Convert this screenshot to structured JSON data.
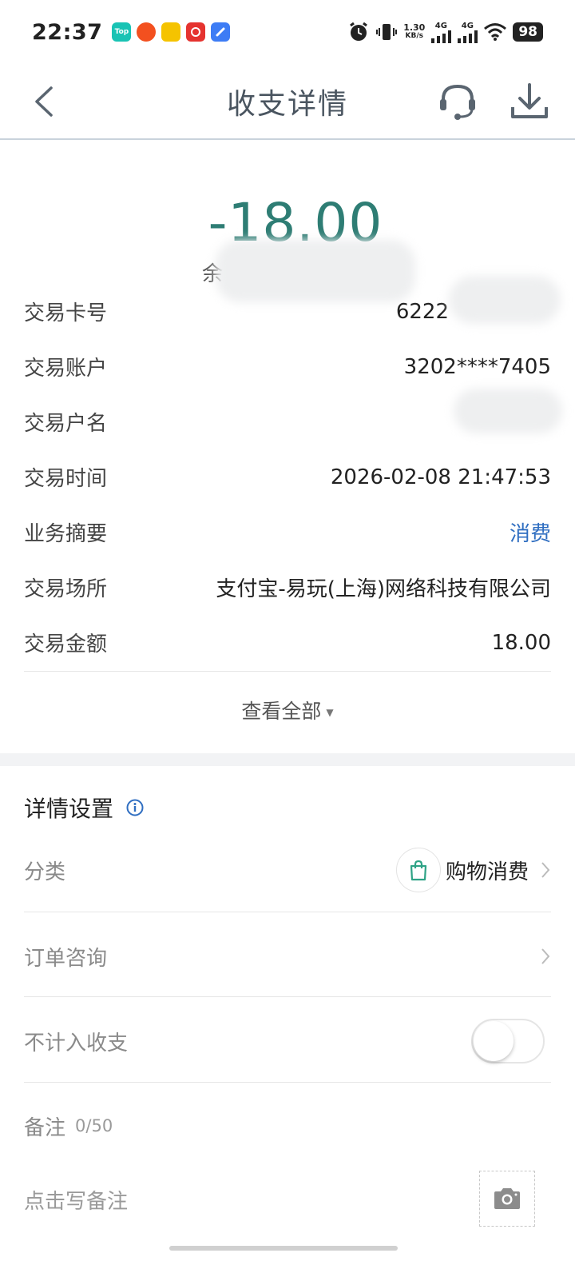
{
  "status_bar": {
    "time": "22:37",
    "apps": [
      {
        "icon": "top-app-icon",
        "label": "Top",
        "color": "#19c3b4"
      },
      {
        "icon": "coupon-app-icon",
        "label": "",
        "color": "#f3501f"
      },
      {
        "icon": "game-app-icon",
        "label": "",
        "color": "#f5c300"
      },
      {
        "icon": "netease-music-icon",
        "label": "",
        "color": "#e5332f"
      },
      {
        "icon": "browser-app-icon",
        "label": "",
        "color": "#3d7cf5"
      }
    ],
    "net_speed_value": "1.30",
    "net_speed_unit": "KB/s",
    "signal1_label": "4G",
    "signal2_label": "4G",
    "battery": "98"
  },
  "nav": {
    "title": "收支详情",
    "back_icon": "back-arrow-icon",
    "service_icon": "customer-service-icon",
    "download_icon": "download-icon"
  },
  "summary": {
    "amount": "-18.00",
    "amount_color": "#2e7d74",
    "balance_prefix": "余"
  },
  "details": [
    {
      "label": "交易卡号",
      "value": "6222"
    },
    {
      "label": "交易账户",
      "value": "3202****7405"
    },
    {
      "label": "交易户名",
      "value": ""
    },
    {
      "label": "交易时间",
      "value": "2026-02-08 21:47:53"
    },
    {
      "label": "业务摘要",
      "value": "消费"
    },
    {
      "label": "交易场所",
      "value": "支付宝-易玩(上海)网络科技有限公司"
    },
    {
      "label": "交易金额",
      "value": "18.00"
    }
  ],
  "link_color": "#2f6ec1",
  "view_all": "查看全部",
  "settings": {
    "title": "详情设置",
    "category_label": "分类",
    "category_value": "购物消费",
    "category_icon": "shopping-bag-icon",
    "order_label": "订单咨询",
    "exclude_label": "不计入收支",
    "exclude_enabled": false,
    "note_label": "备注",
    "note_count": "0/50",
    "note_placeholder": "点击写备注",
    "camera_icon": "camera-icon"
  }
}
